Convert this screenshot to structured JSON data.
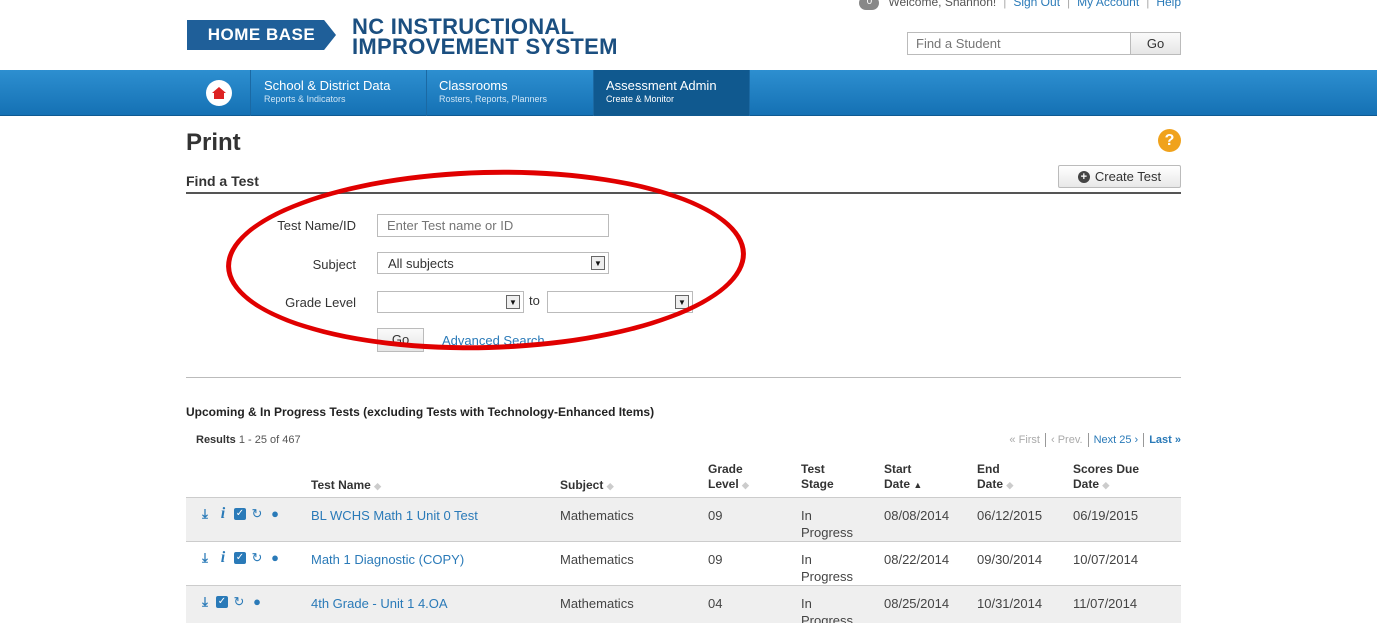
{
  "header": {
    "logo_text": "HOME BASE",
    "system_title_line1": "NC INSTRUCTIONAL",
    "system_title_line2": "IMPROVEMENT SYSTEM",
    "notification_count": "0",
    "welcome": "Welcome, Shannon!",
    "sign_out": "Sign Out",
    "my_account": "My Account",
    "help": "Help",
    "find_student_placeholder": "Find a Student",
    "go": "Go"
  },
  "nav": {
    "items": [
      {
        "label": "School & District Data",
        "sub": "Reports & Indicators"
      },
      {
        "label": "Classrooms",
        "sub": "Rosters, Reports, Planners"
      },
      {
        "label": "Assessment Admin",
        "sub": "Create & Monitor"
      }
    ]
  },
  "page": {
    "title": "Print",
    "section_title": "Find a Test",
    "create_test": "Create Test",
    "help_glyph": "?"
  },
  "form": {
    "test_name_label": "Test Name/ID",
    "test_name_placeholder": "Enter Test name or ID",
    "subject_label": "Subject",
    "subject_value": "All subjects",
    "grade_label": "Grade Level",
    "grade_from": "",
    "grade_to": "",
    "to": "to",
    "go": "Go",
    "advanced_search": "Advanced Search"
  },
  "list": {
    "title": "Upcoming & In Progress Tests (excluding Tests with Technology-Enhanced Items)",
    "results_label": "Results",
    "results_range": "1 - 25 of 467",
    "pager": {
      "first": "« First",
      "prev": "‹ Prev.",
      "next": "Next 25 ›",
      "last": "Last »"
    },
    "columns": {
      "test_name": "Test Name",
      "subject": "Subject",
      "grade_line1": "Grade",
      "grade_line2": "Level",
      "stage_line1": "Test",
      "stage_line2": "Stage",
      "start_line1": "Start",
      "start_line2": "Date",
      "end_line1": "End",
      "end_line2": "Date",
      "due_line1": "Scores Due",
      "due_line2": "Date"
    },
    "rows": [
      {
        "name": "BL WCHS Math 1 Unit 0 Test",
        "subject": "Mathematics",
        "grade": "09",
        "stage1": "In",
        "stage2": "Progress",
        "start": "08/08/2014",
        "end": "06/12/2015",
        "due": "06/19/2015"
      },
      {
        "name": "Math 1 Diagnostic (COPY)",
        "subject": "Mathematics",
        "grade": "09",
        "stage1": "In",
        "stage2": "Progress",
        "start": "08/22/2014",
        "end": "09/30/2014",
        "due": "10/07/2014"
      },
      {
        "name": "4th Grade - Unit 1 4.OA",
        "subject": "Mathematics",
        "grade": "04",
        "stage1": "In",
        "stage2": "Progress",
        "start": "08/25/2014",
        "end": "10/31/2014",
        "due": "11/07/2014"
      }
    ]
  },
  "colors": {
    "nav_blue": "#1f7fc1",
    "link": "#2a7ab8",
    "annotation_red": "#e00000",
    "help_orange": "#f0a21c"
  }
}
